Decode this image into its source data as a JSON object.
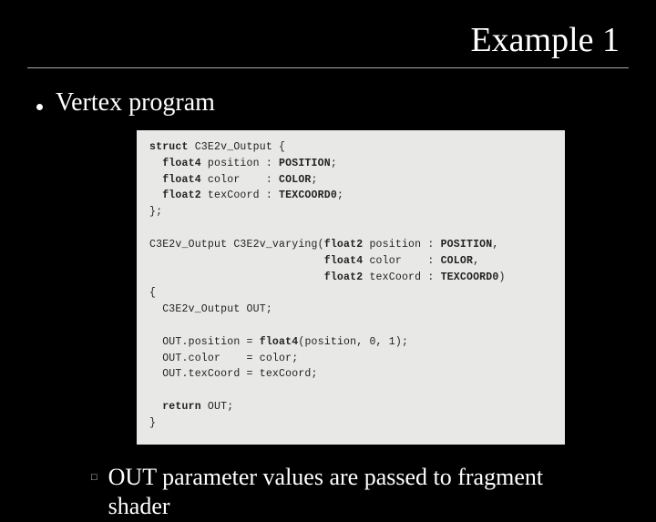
{
  "title": "Example 1",
  "bullet1": "Vertex program",
  "code": {
    "l1a": "struct",
    "l1b": " C3E2v_Output {",
    "l2a": "float4",
    "l2b": " position : ",
    "l2c": "POSITION",
    "l2d": ";",
    "l3a": "float4",
    "l3b": " color    : ",
    "l3c": "COLOR",
    "l3d": ";",
    "l4a": "float2",
    "l4b": " texCoord : ",
    "l4c": "TEXCOORD0",
    "l4d": ";",
    "l5": "};",
    "blank1": "",
    "l6a": "C3E2v_Output C3E2v_varying(",
    "l6b": "float2",
    "l6c": " position : ",
    "l6d": "POSITION",
    "l6e": ",",
    "l7a": "                           ",
    "l7b": "float4",
    "l7c": " color    : ",
    "l7d": "COLOR",
    "l7e": ",",
    "l8a": "                           ",
    "l8b": "float2",
    "l8c": " texCoord : ",
    "l8d": "TEXCOORD0",
    "l8e": ")",
    "l9": "{",
    "l10": "  C3E2v_Output OUT;",
    "blank2": "",
    "l11a": "  OUT.position = ",
    "l11b": "float4",
    "l11c": "(position, 0, 1);",
    "l12": "  OUT.color    = color;",
    "l13": "  OUT.texCoord = texCoord;",
    "blank3": "",
    "l14a": "  ",
    "l14b": "return",
    "l14c": " OUT;",
    "l15": "}"
  },
  "sub_bullet_mark": "□",
  "sub_bullet_text": "OUT parameter values are passed to fragment shader"
}
